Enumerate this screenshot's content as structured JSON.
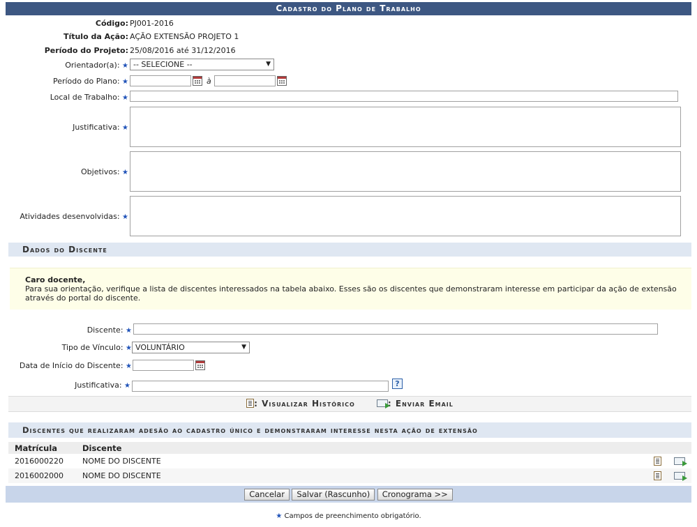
{
  "form": {
    "title": "Cadastro do Plano de Trabalho",
    "codigo_label": "Código:",
    "codigo_value": "PJ001-2016",
    "titulo_label": "Título da Ação:",
    "titulo_value": "AÇÃO EXTENSÃO PROJETO 1",
    "periodo_projeto_label": "Período do Projeto:",
    "periodo_projeto_value": "25/08/2016 até 31/12/2016",
    "orientador_label": "Orientador(a):",
    "orientador_selected": "-- SELECIONE --",
    "periodo_plano_label": "Período do Plano:",
    "periodo_plano_sep": "à",
    "local_label": "Local de Trabalho:",
    "justificativa_label": "Justificativa:",
    "objetivos_label": "Objetivos:",
    "atividades_label": "Atividades desenvolvidas:",
    "required_mark": "★"
  },
  "discente_section": {
    "title": "Dados do Discente",
    "notice_title": "Caro docente,",
    "notice_text": "Para sua orientação, verifique a lista de discentes interessados na tabela abaixo. Esses são os discentes que demonstraram interesse em participar da ação de extensão através do portal do discente.",
    "discente_label": "Discente:",
    "vinculo_label": "Tipo de Vínculo:",
    "vinculo_selected": "VOLUNTÁRIO",
    "data_inicio_label": "Data de Início do Discente:",
    "justificativa_label": "Justificativa:",
    "help_glyph": "?"
  },
  "links": {
    "historico": ": Visualizar Histórico",
    "email": ": Enviar Email"
  },
  "list": {
    "title": "Discentes que realizaram adesão ao cadastro único e demonstraram interesse nesta ação de extensão",
    "headers": [
      "Matrícula",
      "Discente"
    ],
    "rows": [
      {
        "matricula": "2016000220",
        "discente": "NOME DO DISCENTE"
      },
      {
        "matricula": "2016002000",
        "discente": "NOME DO DISCENTE"
      }
    ]
  },
  "buttons": {
    "cancelar": "Cancelar",
    "salvar": "Salvar (Rascunho)",
    "cronograma": "Cronograma >>"
  },
  "footer": {
    "mark": "★",
    "text": " Campos de preenchimento obrigatório."
  }
}
